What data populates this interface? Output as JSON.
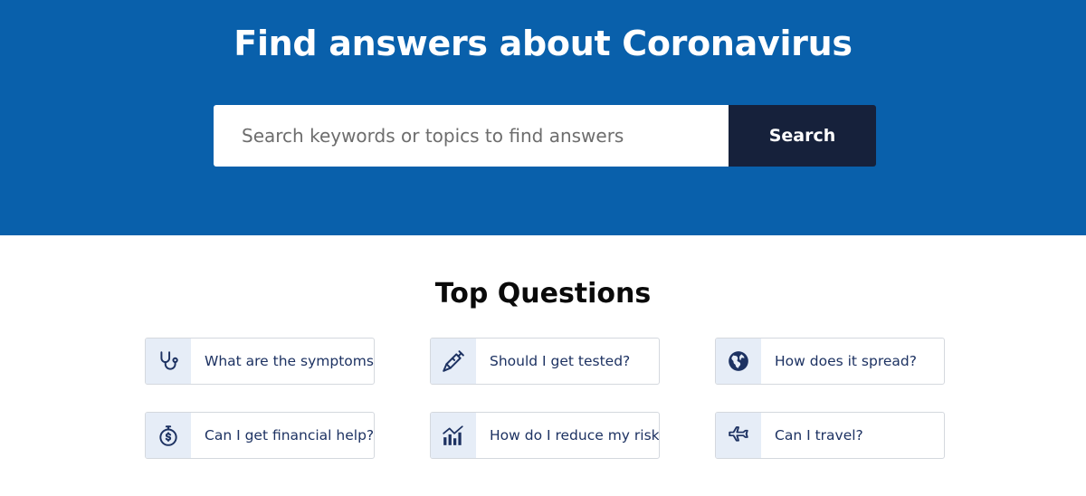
{
  "hero": {
    "title": "Find answers about Coronavirus",
    "background_color": "#0960ab"
  },
  "search": {
    "placeholder": "Search keywords or topics to find answers",
    "value": "",
    "button_label": "Search",
    "button_color": "#16213b"
  },
  "top_questions": {
    "title": "Top Questions",
    "items": [
      {
        "label": "What are the symptoms?",
        "icon": "stethoscope-icon"
      },
      {
        "label": "Should I get tested?",
        "icon": "syringe-icon"
      },
      {
        "label": "How does it spread?",
        "icon": "globe-icon"
      },
      {
        "label": "Can I get financial help?",
        "icon": "stopwatch-dollar-icon"
      },
      {
        "label": "How do I reduce my risk?",
        "icon": "chart-trend-icon"
      },
      {
        "label": "Can I travel?",
        "icon": "airplane-icon"
      }
    ],
    "icon_color": "#1d3262",
    "icon_background": "#e6edf7"
  }
}
